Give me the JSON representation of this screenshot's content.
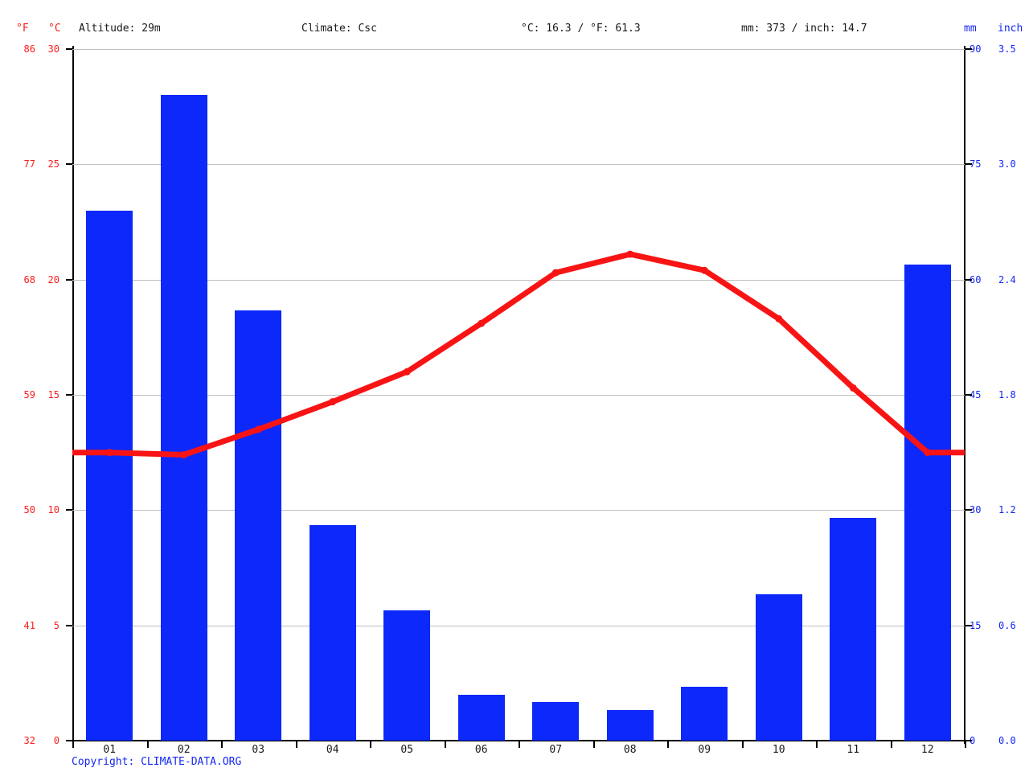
{
  "header": {
    "unit_f": "°F",
    "unit_c": "°C",
    "altitude": "Altitude: 29m",
    "climate": "Climate: Csc",
    "temperature_summary": "°C: 16.3 / °F: 61.3",
    "precipitation_summary": "mm: 373 / inch: 14.7",
    "unit_mm": "mm",
    "unit_inch": "inch"
  },
  "footer": {
    "copyright": "Copyright: CLIMATE-DATA.ORG"
  },
  "colors": {
    "precipitation_bar": "#0d28fa",
    "temperature_line": "#f81414",
    "left_axis_text": "#fc1c1c",
    "right_axis_text": "#1528f0",
    "gridline": "#bfbfbf",
    "axis_line": "#000000",
    "header_text": "#1a1a1a",
    "background": "#ffffff"
  },
  "chart_data": {
    "type": "bar",
    "title": "",
    "subtitle": "",
    "xlabel": "",
    "ylabel": "",
    "grid": true,
    "legend_position": "none",
    "categories": [
      "01",
      "02",
      "03",
      "04",
      "05",
      "06",
      "07",
      "08",
      "09",
      "10",
      "11",
      "12"
    ],
    "series": [
      {
        "name": "Precipitation",
        "type": "bar",
        "unit": "mm",
        "values": [
          69,
          84,
          56,
          28,
          17,
          6,
          5,
          4,
          7,
          19,
          29,
          62
        ],
        "axis": "right"
      },
      {
        "name": "Temperature",
        "type": "line",
        "unit": "°C",
        "values": [
          12.5,
          12.4,
          13.5,
          14.7,
          16.0,
          18.1,
          20.3,
          21.1,
          20.4,
          18.3,
          15.3,
          12.5
        ],
        "axis": "left"
      }
    ],
    "axes": {
      "left_c": {
        "label": "°C",
        "ticks": [
          30,
          25,
          20,
          15,
          10,
          5,
          0
        ],
        "range": [
          0,
          30
        ]
      },
      "left_f": {
        "label": "°F",
        "ticks": [
          86,
          77,
          68,
          59,
          50,
          41,
          32
        ],
        "range": [
          32,
          86
        ]
      },
      "right_mm": {
        "label": "mm",
        "ticks": [
          90,
          75,
          60,
          45,
          30,
          15,
          0
        ],
        "range": [
          0,
          90
        ]
      },
      "right_inch": {
        "label": "inch",
        "ticks": [
          "3.5",
          "3.0",
          "2.4",
          "1.8",
          "1.2",
          "0.6",
          "0.0"
        ],
        "range": [
          0.0,
          3.5
        ]
      }
    }
  }
}
